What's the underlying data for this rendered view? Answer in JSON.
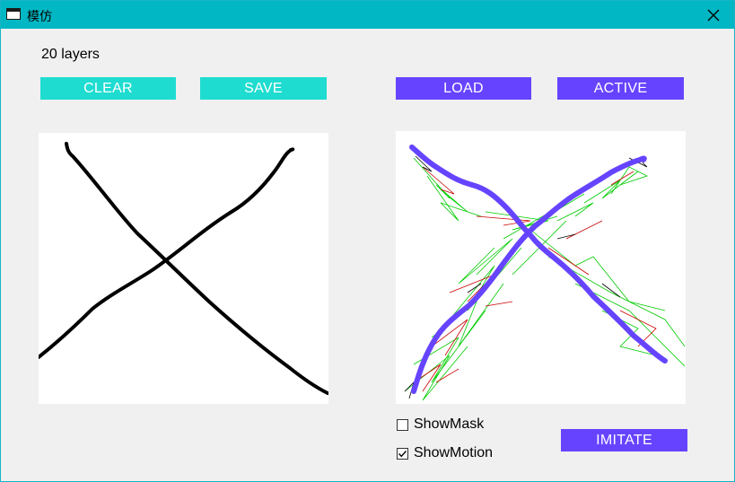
{
  "window": {
    "title": "模仿"
  },
  "status": {
    "layers_text": "20 layers"
  },
  "buttons": {
    "clear": "CLEAR",
    "save": "SAVE",
    "load": "LOAD",
    "active": "ACTIVE",
    "imitate": "IMITATE"
  },
  "options": {
    "show_mask": {
      "label": "ShowMask",
      "checked": false
    },
    "show_motion": {
      "label": "ShowMotion",
      "checked": true
    }
  },
  "colors": {
    "titlebar": "#00b7c3",
    "teal_button": "#1fdcd0",
    "purple_button": "#6644ff",
    "stroke": "#000000",
    "imitation_stroke": "#6644ff",
    "motion_green": "#00cc00",
    "motion_red": "#cc0000"
  }
}
